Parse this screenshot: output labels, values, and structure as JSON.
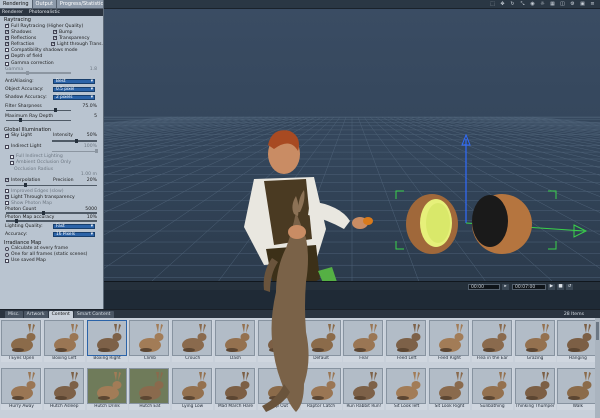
{
  "left_panel": {
    "tabs": [
      "Rendering",
      "Output",
      "Progress/Statistics"
    ],
    "subtabs": [
      "Renderer",
      "Photorealistic"
    ],
    "raytracing": {
      "title": "Raytracing",
      "full_raytracing": "Full Raytracing (Higher Quality)",
      "shadows": "Shadows",
      "bump": "Bump",
      "reflections": "Reflections",
      "transparency": "Transparency",
      "refraction": "Refraction",
      "light_through_trans": "Light through Trans.",
      "compat_shadows": "Compatibility shadows mode",
      "depth_of_field": "Depth of field",
      "gamma_correction": "Gamma correction",
      "gamma_label": "Gamma",
      "gamma_value": "1.8",
      "antialiasing_label": "AntiAliasing:",
      "antialiasing_value": "Best",
      "object_accuracy_label": "Object Accuracy:",
      "object_accuracy_value": "0.5 pixel",
      "shadow_accuracy_label": "Shadow Accuracy:",
      "shadow_accuracy_value": "2 pixels",
      "filter_sharpness_label": "Filter Sharpness",
      "filter_sharpness_value": "75.0%",
      "max_ray_depth_label": "Maximum Ray Depth",
      "max_ray_depth_value": "5"
    },
    "global_illumination": {
      "title": "Global Illumination",
      "sky_light": "Sky Light",
      "intensity_label": "Intensity",
      "intensity_value": "50%",
      "indirect_light": "Indirect Light",
      "indirect_value": "100%",
      "full_indirect": "Full Indirect Lighting",
      "ambient_occlusion": "Ambient Occlusion Only",
      "occlusion_radius_label": "Occlusion Radius",
      "occlusion_radius_value": "1.00 m",
      "interpolation": "Interpolation",
      "precision_label": "Precision",
      "precision_value": "20%",
      "improved_edges": "Improved Edges (slow)",
      "light_through_transparency": "Light Through transparency",
      "show_photon_map": "Show Photon Map",
      "photon_count_label": "Photon Count",
      "photon_count_value": "5000",
      "photon_map_accuracy_label": "Photon Map accuracy",
      "photon_map_accuracy_value": "10%",
      "lighting_quality_label": "Lighting Quality:",
      "lighting_quality_value": "Fast",
      "accuracy_label": "Accuracy:",
      "accuracy_value": "16 Pixels",
      "irradiance_title": "Irradiance Map",
      "calc_every_frame": "Calculate at every frame",
      "one_for_all": "One for all frames (static scenes)",
      "use_saved_map": "Use saved Map"
    }
  },
  "viewport": {
    "top_icons": [
      "select-icon",
      "move-icon",
      "rotate-icon",
      "scale-icon",
      "camera-icon",
      "light-icon",
      "grid-icon",
      "view-icon",
      "gear-icon",
      "layout-icon",
      "menu-icon"
    ],
    "time_field_1": "00:00",
    "time_field_2": "00:07:00"
  },
  "library": {
    "tabs": [
      "Misc.",
      "Artwork",
      "Content",
      "Smart Content"
    ],
    "active_tab": "Content",
    "count": "28 Items",
    "row1": [
      "I Eyes Open",
      "Boxing Left",
      "Boxing Right",
      "Climb",
      "Crouch",
      "Dash",
      "",
      "Default",
      "Fear",
      "Feed Left",
      "Feed Right",
      "Flea in the Ear",
      "Grazing",
      "Hanging"
    ],
    "row2": [
      "Hurry Away",
      "Hutch Asleep",
      "Hutch Drink",
      "Hutch Eat",
      "Lying Low",
      "Mad March Hare",
      "Peep Out",
      "Raptor Catch",
      "Run Rabbit Run!",
      "Sit Look left",
      "Sit Look Right",
      "Sunbathing",
      "Thinking Thumper",
      "Walk"
    ]
  }
}
